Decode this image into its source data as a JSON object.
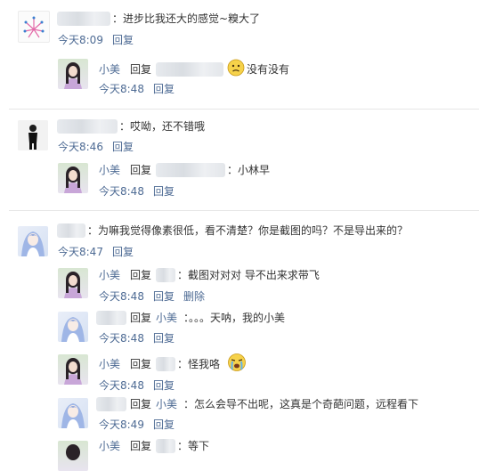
{
  "colors": {
    "link": "#4e6b94",
    "text": "#333333",
    "divider": "#e6e6e6"
  },
  "comments": [
    {
      "text": "：进步比我还大的感觉~糗大了",
      "time": "今天8:09",
      "reply": "回复",
      "replies": [
        {
          "author": "小美",
          "reply_word": "回复",
          "text": "没有没有",
          "emoji": "worried-face-icon",
          "time": "今天8:48",
          "reply": "回复"
        }
      ]
    },
    {
      "text": "：哎呦，还不错哦",
      "time": "今天8:46",
      "reply": "回复",
      "replies": [
        {
          "author": "小美",
          "reply_word": "回复",
          "text": "：小林早",
          "time": "今天8:48",
          "reply": "回复"
        }
      ]
    },
    {
      "text": "：为嘛我觉得像素很低，看不清楚？你是截图的吗？不是导出来的？",
      "time": "今天8:47",
      "reply": "回复",
      "replies": [
        {
          "author": "小美",
          "reply_word": "回复",
          "text": "：截图对对对 导不出来求带飞",
          "time": "今天8:48",
          "reply": "回复",
          "delete": "删除"
        },
        {
          "reply_word": "回复",
          "target": "小美",
          "text": "：。。。天呐，我的小美",
          "time": "今天8:48",
          "reply": "回复"
        },
        {
          "author": "小美",
          "reply_word": "回复",
          "text": "：怪我咯",
          "emoji": "crying-face-icon",
          "time": "今天8:48",
          "reply": "回复"
        },
        {
          "reply_word": "回复",
          "target": "小美",
          "text": "：怎么会导不出呢，这真是个奇葩问题，远程看下",
          "time": "今天8:49",
          "reply": "回复"
        },
        {
          "author": "小美",
          "reply_word": "回复",
          "text": "：等下"
        }
      ]
    }
  ]
}
